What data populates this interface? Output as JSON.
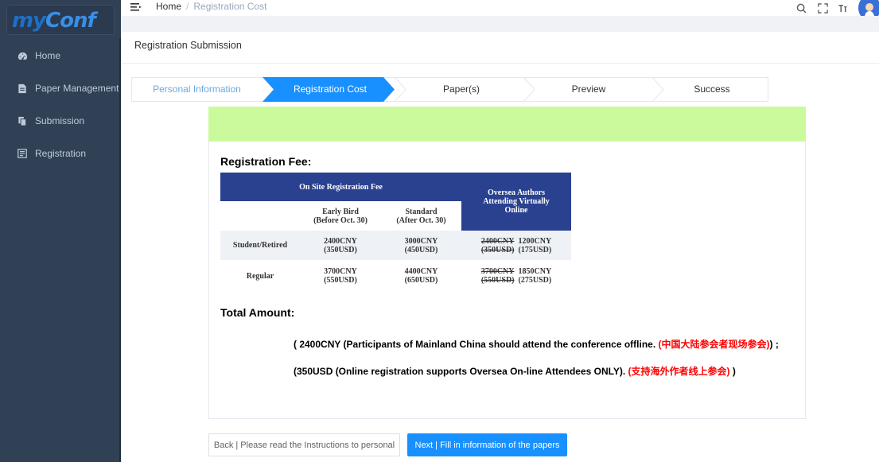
{
  "sidebar": {
    "logo": {
      "part1": "my",
      "part2": "Conf"
    },
    "items": [
      {
        "label": "Home",
        "icon": "dashboard-icon"
      },
      {
        "label": "Paper Management",
        "icon": "document-icon"
      },
      {
        "label": "Submission",
        "icon": "copy-icon"
      },
      {
        "label": "Registration",
        "icon": "form-icon"
      }
    ]
  },
  "topbar": {
    "breadcrumb": {
      "home": "Home",
      "separator": "/",
      "current": "Registration Cost"
    },
    "icons": [
      "search-icon",
      "fullscreen-icon",
      "font-size-icon",
      "avatar"
    ]
  },
  "page": {
    "title": "Registration Submission"
  },
  "steps": [
    {
      "label": "Personal Information",
      "state": "done"
    },
    {
      "label": "Registration Cost",
      "state": "active"
    },
    {
      "label": "Paper(s)",
      "state": "pending"
    },
    {
      "label": "Preview",
      "state": "pending"
    },
    {
      "label": "Success",
      "state": "pending"
    }
  ],
  "fee": {
    "title": "Registration Fee:",
    "onsite_header": "On Site Registration Fee",
    "oversea_header": "Oversea Authors Attending Virtually Online",
    "col_early": {
      "line1": "Early Bird",
      "line2": "(Before Oct. 30)"
    },
    "col_standard": {
      "line1": "Standard",
      "line2": "(After Oct. 30)"
    },
    "rows": [
      {
        "label": "Student/Retired",
        "early": {
          "cny": "2400CNY",
          "usd": "(350USD)"
        },
        "standard": {
          "cny": "3000CNY",
          "usd": "(450USD)"
        },
        "online": {
          "old_cny": "2400CNY",
          "new_cny": "1200CNY",
          "old_usd": "(350USD)",
          "new_usd": "(175USD)"
        }
      },
      {
        "label": "Regular",
        "early": {
          "cny": "3700CNY",
          "usd": "(550USD)"
        },
        "standard": {
          "cny": "4400CNY",
          "usd": "(650USD)"
        },
        "online": {
          "old_cny": "3700CNY",
          "new_cny": "1850CNY",
          "old_usd": "(550USD)",
          "new_usd": "(275USD)"
        }
      }
    ]
  },
  "total": {
    "title": "Total Amount:",
    "line1": {
      "text": "( 2400CNY (Participants of Mainland China should attend the conference offline. ",
      "red": "(中国大陆参会者现场参会)",
      "tail": ") ;"
    },
    "line2": {
      "text": "(350USD (Online registration supports Oversea On-line Attendees ONLY). ",
      "red": "(支持海外作者线上参会)",
      "tail": " )"
    }
  },
  "buttons": {
    "back": "Back | Please read the Instructions to personal",
    "next": "Next | Fill in information of the papers"
  },
  "colors": {
    "sidebar": "#304156",
    "accent": "#3a8ee6",
    "banner": "#cbfa9c",
    "table_header": "#2a4190",
    "button_primary": "#1890ff"
  }
}
